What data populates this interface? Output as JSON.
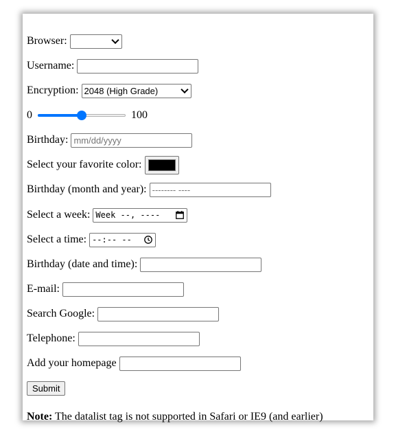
{
  "form": {
    "browser": {
      "label": "Browser:",
      "value": ""
    },
    "username": {
      "label": "Username:",
      "value": ""
    },
    "encryption": {
      "label": "Encryption:",
      "value": "2048 (High Grade)"
    },
    "range": {
      "min_label": "0",
      "max_label": "100",
      "value": 50,
      "min": 0,
      "max": 100
    },
    "birthday": {
      "label": "Birthday:",
      "placeholder": "mm/dd/yyyy"
    },
    "color": {
      "label": "Select your favorite color:",
      "value": "#000000"
    },
    "month": {
      "label": "Birthday (month and year):",
      "placeholder": "--------  ----"
    },
    "week": {
      "label": "Select a week:",
      "placeholder": "Week --, ----"
    },
    "time": {
      "label": "Select a time:",
      "placeholder": "--:-- --"
    },
    "datetime": {
      "label": "Birthday (date and time):",
      "value": ""
    },
    "email": {
      "label": "E-mail:",
      "value": ""
    },
    "search": {
      "label": "Search Google:",
      "value": ""
    },
    "telephone": {
      "label": "Telephone:",
      "value": ""
    },
    "homepage": {
      "label": "Add your homepage",
      "value": ""
    },
    "submit_label": "Submit"
  },
  "note": {
    "bold": "Note:",
    "text": " The datalist tag is not supported in Safari or IE9 (and earlier)"
  },
  "colors": {
    "accent": "#0075ff",
    "border": "#767676",
    "placeholder": "#757575"
  },
  "icons": {
    "select_arrow": "chevron-down-icon",
    "calendar": "calendar-icon",
    "clock": "clock-icon"
  }
}
